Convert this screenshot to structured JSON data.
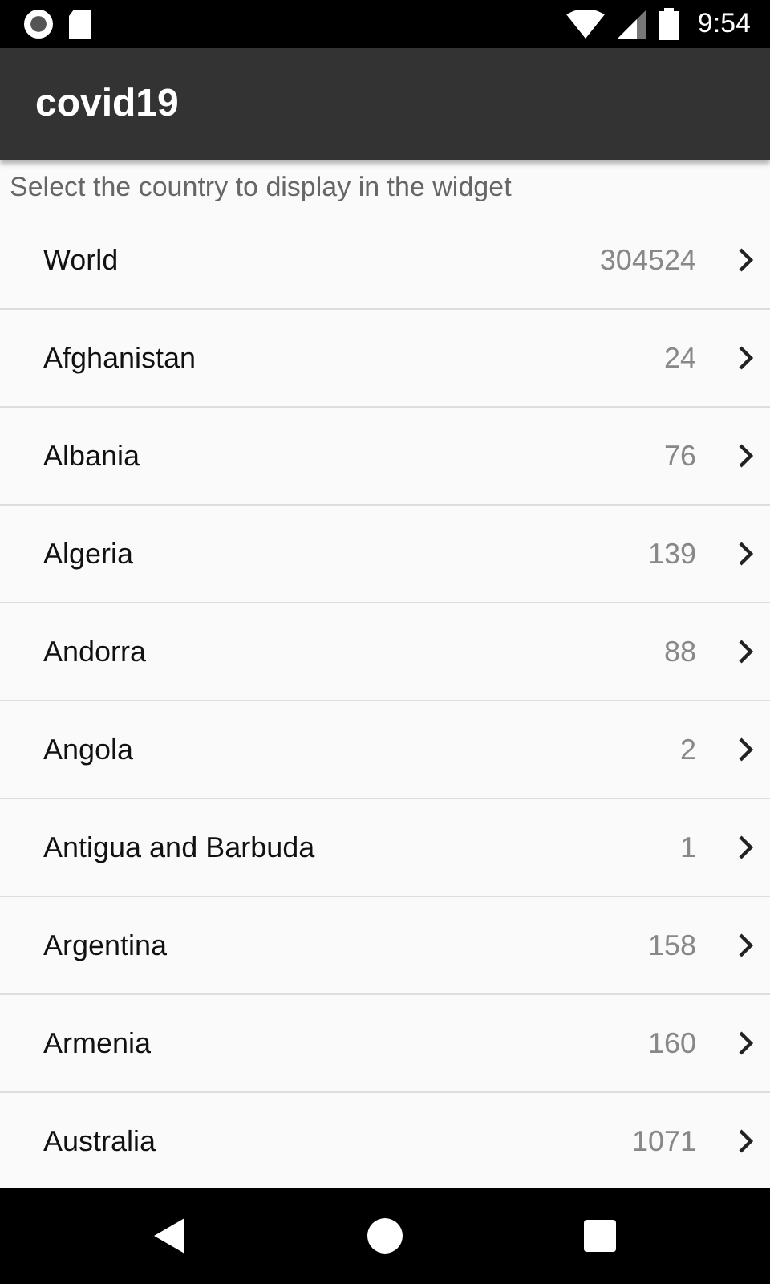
{
  "status_bar": {
    "time": "9:54"
  },
  "app_bar": {
    "title": "covid19"
  },
  "hint": "Select the country to display in the widget",
  "countries": [
    {
      "name": "World",
      "count": "304524"
    },
    {
      "name": "Afghanistan",
      "count": "24"
    },
    {
      "name": "Albania",
      "count": "76"
    },
    {
      "name": "Algeria",
      "count": "139"
    },
    {
      "name": "Andorra",
      "count": "88"
    },
    {
      "name": "Angola",
      "count": "2"
    },
    {
      "name": "Antigua and Barbuda",
      "count": "1"
    },
    {
      "name": "Argentina",
      "count": "158"
    },
    {
      "name": "Armenia",
      "count": "160"
    },
    {
      "name": "Australia",
      "count": "1071"
    }
  ]
}
